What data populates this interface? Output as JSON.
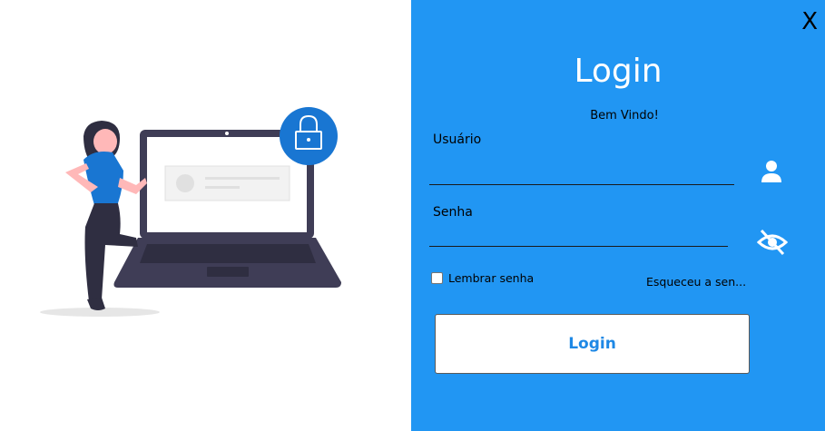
{
  "window": {
    "close_label": "X"
  },
  "login_panel": {
    "title": "Login",
    "welcome": "Bem Vindo!",
    "username_label": "Usuário",
    "username_value": "",
    "password_label": "Senha",
    "password_value": "",
    "remember_label": "Lembrar senha",
    "remember_checked": false,
    "forgot_label": "Esqueceu a sen...",
    "login_button": "Login"
  },
  "colors": {
    "panel_bg": "#2196f3",
    "button_text": "#1e88e5",
    "illustration_accent": "#1976d2",
    "laptop": "#3f3d56"
  },
  "icons": {
    "user": "user-icon",
    "eye": "eye-slash-icon",
    "lock": "lock-icon"
  }
}
